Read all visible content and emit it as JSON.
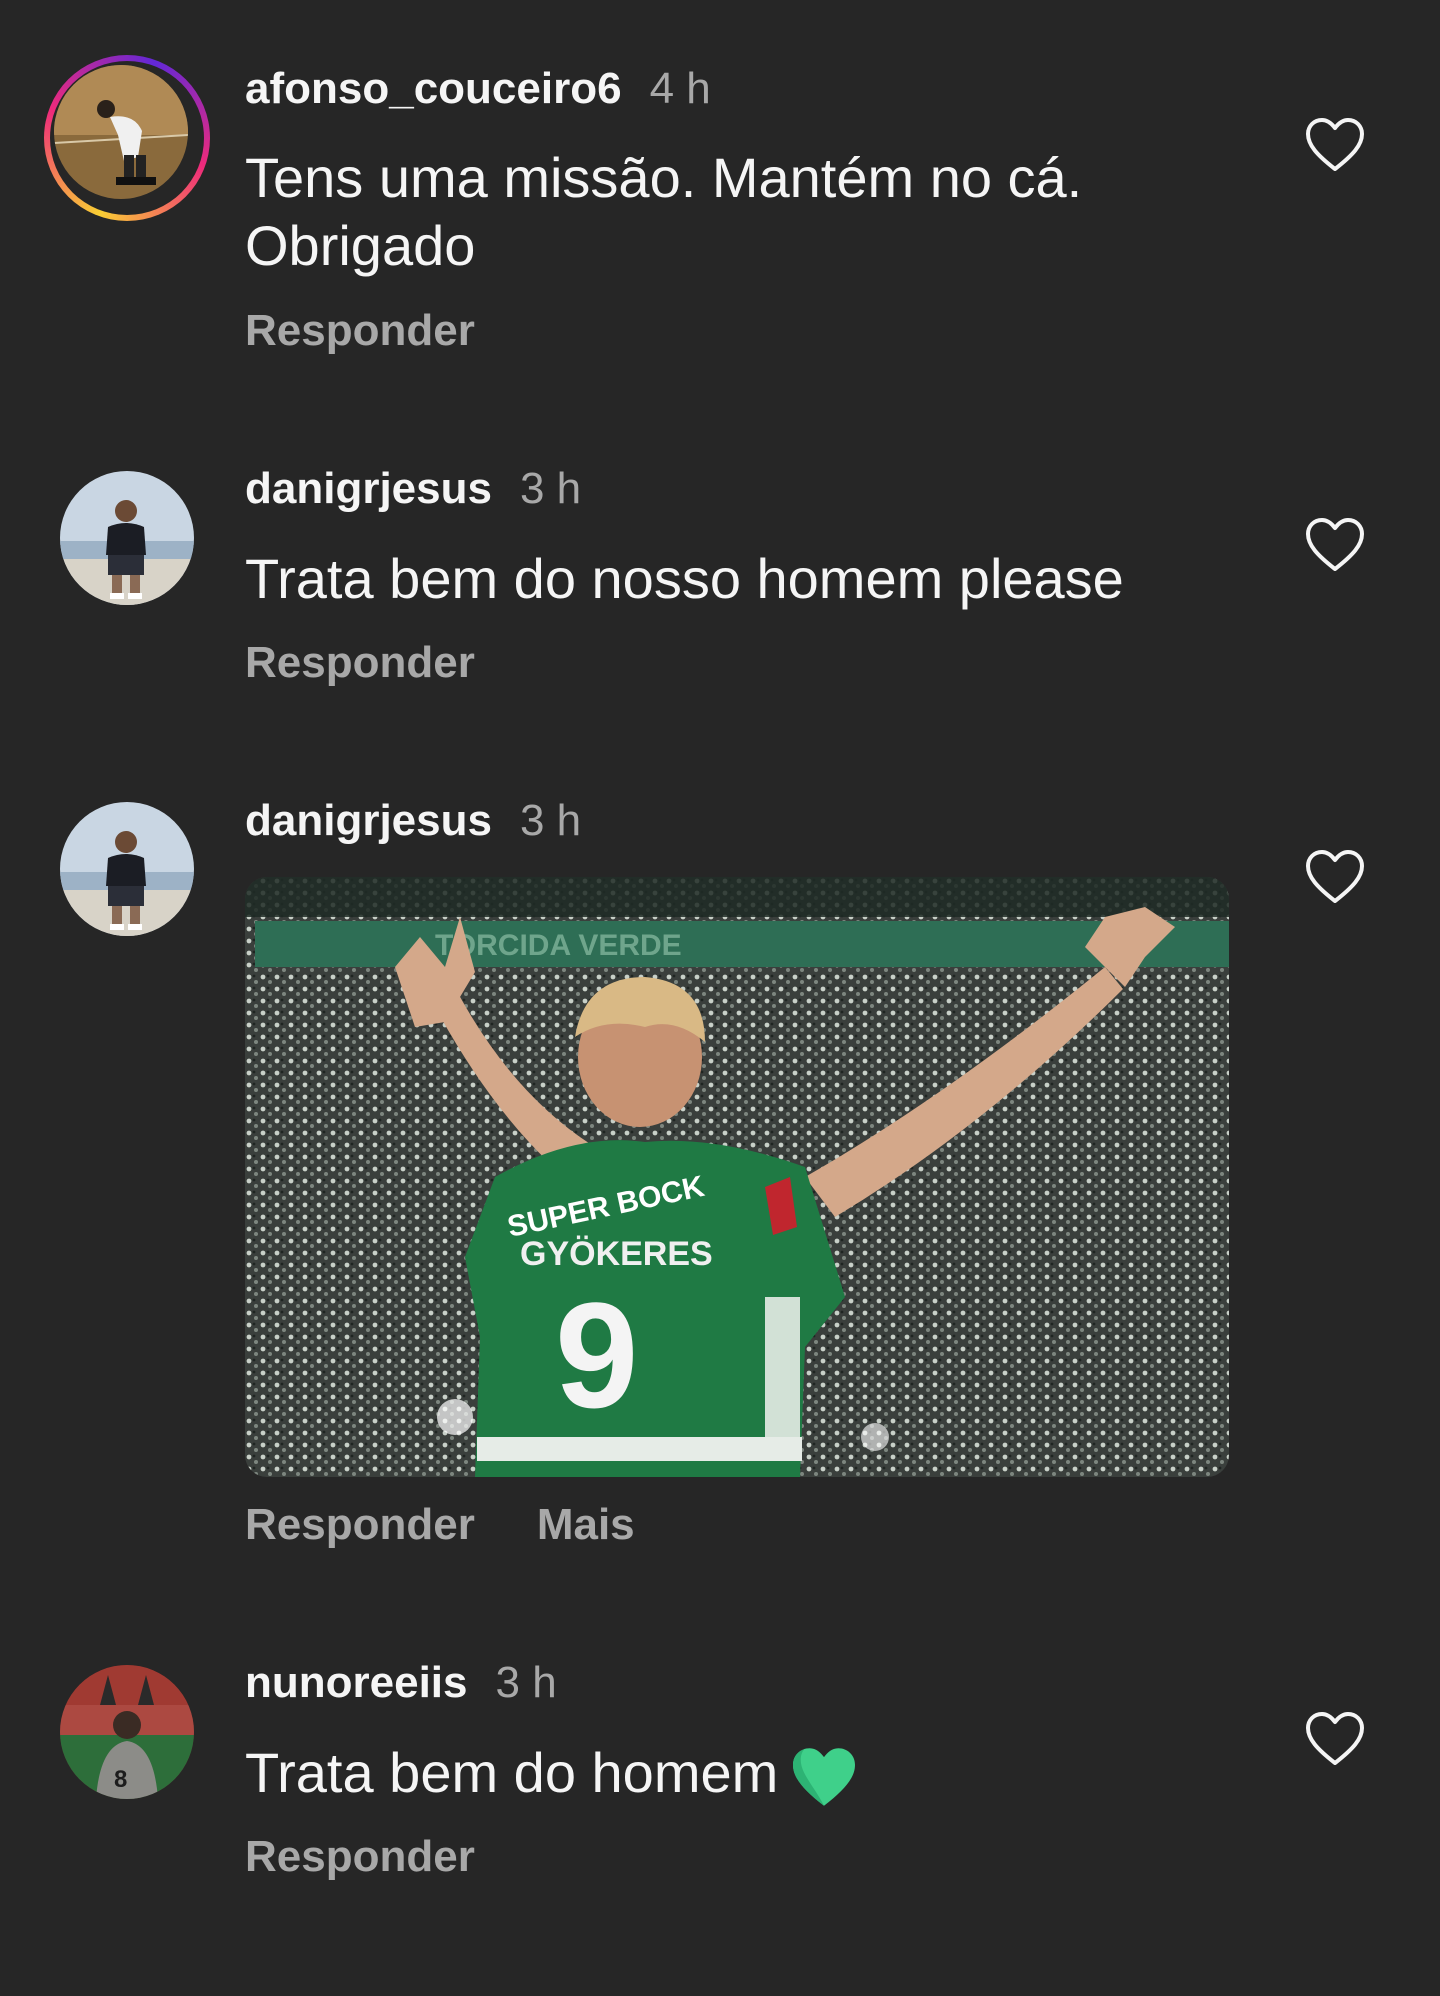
{
  "comments": [
    {
      "username": "afonso_couceiro6",
      "time": "4 h",
      "text": "Tens uma missão. Mantém no cá.\nObrigado",
      "reply_label": "Responder",
      "has_story_ring": true
    },
    {
      "username": "danigrjesus",
      "time": "3 h",
      "text": "Trata bem do nosso homem please",
      "reply_label": "Responder"
    },
    {
      "username": "danigrjesus",
      "time": "3 h",
      "image": {
        "banner_text": "TORCIDA VERDE",
        "shirt_sponsor": "SUPER BOCK",
        "shirt_name": "GYÖKERES",
        "shirt_number": "9"
      },
      "reply_label": "Responder",
      "more_label": "Mais"
    },
    {
      "username": "nunoreeiis",
      "time": "3 h",
      "text": "Trata bem do homem",
      "emoji": "green-heart",
      "reply_label": "Responder"
    }
  ],
  "colors": {
    "background": "#262626",
    "text": "#f5f5f5",
    "secondary": "#a8a8a8",
    "jersey_green": "#1f7a44",
    "heart_emoji": "#3fd08a"
  },
  "icons": [
    "like-heart-icon",
    "green-heart-emoji"
  ]
}
